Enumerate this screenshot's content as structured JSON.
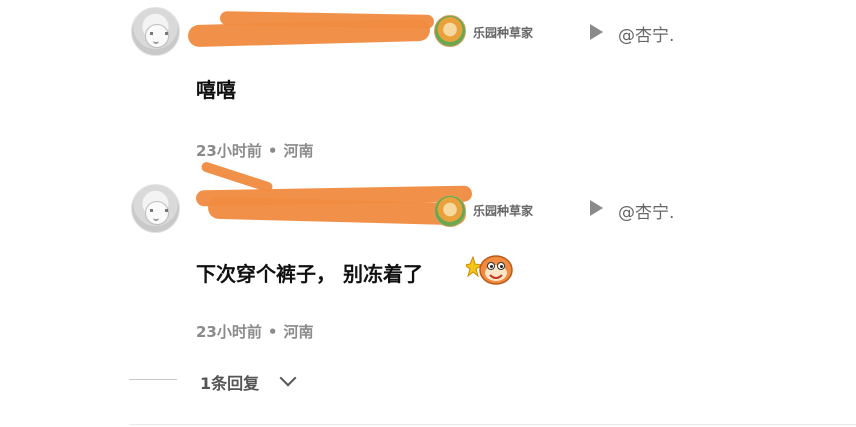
{
  "comments": [
    {
      "badge_label": "乐园种草家",
      "reply_to": "@杏宁.",
      "text": "嘻嘻",
      "time": "23小时前",
      "location": "河南"
    },
    {
      "badge_label": "乐园种草家",
      "reply_to": "@杏宁.",
      "text": "下次穿个裤子， 别冻着了",
      "time": "23小时前",
      "location": "河南"
    }
  ],
  "replies": {
    "label": "1条回复"
  },
  "colors": {
    "redaction": "#f08b3f",
    "meta": "#8b8b8b"
  },
  "icons": [
    "avatar",
    "badge-icon",
    "play-icon",
    "emoji-sticker-icon",
    "chevron-down-icon"
  ]
}
